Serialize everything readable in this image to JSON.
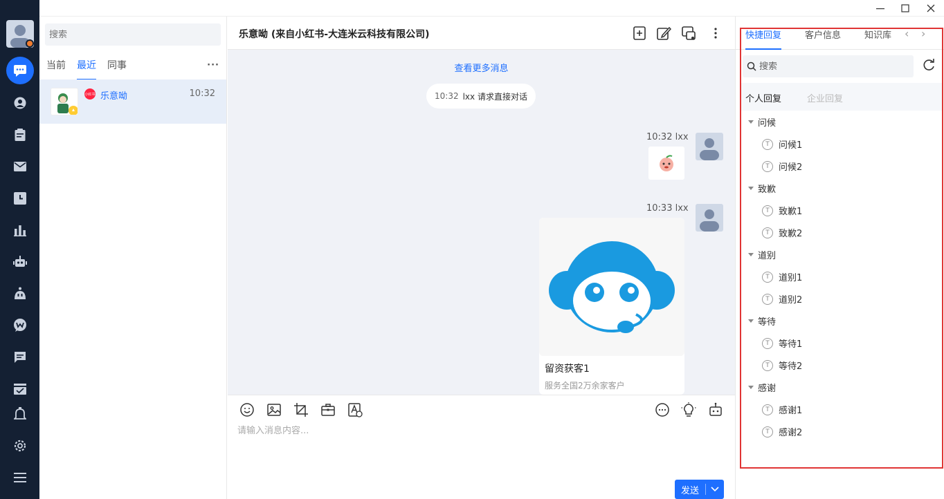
{
  "window": {
    "minimize_icon": "minimize-icon",
    "maximize_icon": "maximize-icon",
    "close_icon": "close-icon"
  },
  "sidebar": {
    "items": [
      {
        "icon": "chat-bubble-icon",
        "active": true
      },
      {
        "icon": "user-icon"
      },
      {
        "icon": "clipboard-icon"
      },
      {
        "icon": "mail-icon"
      },
      {
        "icon": "clock-icon"
      },
      {
        "icon": "bar-chart-icon"
      },
      {
        "icon": "robot-icon"
      },
      {
        "icon": "bot-head-icon"
      },
      {
        "icon": "w-chat-icon"
      },
      {
        "icon": "message-square-icon"
      },
      {
        "icon": "checklist-icon"
      },
      {
        "icon": "bell-icon"
      },
      {
        "icon": "gear-icon"
      },
      {
        "icon": "menu-icon"
      }
    ]
  },
  "conversations": {
    "search_placeholder": "搜索",
    "tabs": [
      "当前",
      "最近",
      "同事"
    ],
    "active_tab": "最近",
    "items": [
      {
        "name": "乐意呦",
        "time": "10:32"
      }
    ]
  },
  "chat": {
    "title": "乐意呦 (来自小红书-大连米云科技有限公司)",
    "load_more": "查看更多消息",
    "system_message": {
      "time": "10:32",
      "text": "lxx 请求直接对话"
    },
    "messages": [
      {
        "time": "10:32",
        "sender": "lxx",
        "type": "sticker"
      },
      {
        "time": "10:33",
        "sender": "lxx",
        "type": "card",
        "card_title": "留资获客1",
        "card_subtitle": "服务全国2万余家客户"
      }
    ],
    "input_placeholder": "请输入消息内容...",
    "send_label": "发送"
  },
  "right_panel": {
    "tabs": [
      "快捷回复",
      "客户信息",
      "知识库"
    ],
    "active_tab": "快捷回复",
    "search_placeholder": "搜索",
    "subtabs": [
      "个人回复",
      "企业回复"
    ],
    "active_subtab": "个人回复",
    "groups": [
      {
        "name": "问候",
        "items": [
          "问候1",
          "问候2"
        ]
      },
      {
        "name": "致歉",
        "items": [
          "致歉1",
          "致歉2"
        ]
      },
      {
        "name": "道别",
        "items": [
          "道别1",
          "道别2"
        ]
      },
      {
        "name": "等待",
        "items": [
          "等待1",
          "等待2"
        ]
      },
      {
        "name": "感谢",
        "items": [
          "感谢1",
          "感谢2"
        ]
      }
    ],
    "leaf_icon_letter": "T"
  },
  "colors": {
    "accent": "#1e6fff",
    "rail": "#142033",
    "highlight_frame": "#e03434"
  }
}
